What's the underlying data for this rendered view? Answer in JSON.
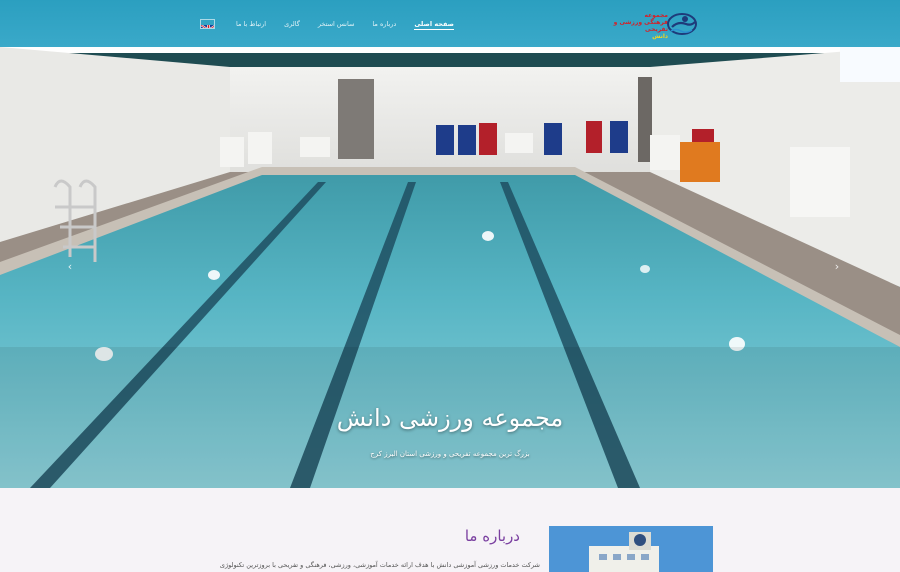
{
  "nav": {
    "items": [
      {
        "label": "ارتباط با ما",
        "active": false
      },
      {
        "label": "گالری",
        "active": false
      },
      {
        "label": "سانس استخر",
        "active": false
      },
      {
        "label": "درباره ما",
        "active": false
      },
      {
        "label": "صفحه اصلی",
        "active": true
      }
    ],
    "language_flag": "uk-flag-icon"
  },
  "logo": {
    "line1": "مجموعه",
    "line2": "فرهنگی ورزشی و تفریحی",
    "line3": "دانش",
    "colors": {
      "red": "#d61f26",
      "yellow": "#f2d321",
      "navy": "#1e3b7a"
    }
  },
  "hero": {
    "title": "مجموعه ورزشی دانش",
    "subtitle": "بزرگ ترین مجموعه تفریحی و ورزشی استان البرز کرج",
    "prev_icon": "chevron-left-icon",
    "next_icon": "chevron-right-icon"
  },
  "about": {
    "title": "درباره ما",
    "text": "شرکت خدمات ورزشی آموزشی دانش با هدف ارائه خدمات آموزشی، ورزشی، فرهنگی و تفریحی با بروزترین تکنولوژی"
  },
  "colors": {
    "header": "#2b9fc0",
    "accent": "#7a3fa0",
    "background": "#f6f3f7"
  }
}
